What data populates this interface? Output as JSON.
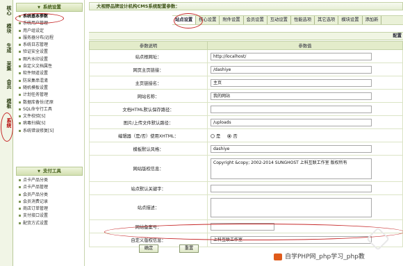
{
  "left_tabs": [
    {
      "label": "核心"
    },
    {
      "label": "模块"
    },
    {
      "label": "生成"
    },
    {
      "label": "采集"
    },
    {
      "label": "会员"
    },
    {
      "label": "模板"
    },
    {
      "label": "系统",
      "active": true
    }
  ],
  "menu": {
    "group1_title": "系统设置",
    "group1_items": [
      {
        "label": "系统基本参数",
        "active": true
      },
      {
        "label": "系统用户管理"
      },
      {
        "label": "用户组设定"
      },
      {
        "label": "服务器分布/远程"
      },
      {
        "label": "系统日志管理"
      },
      {
        "label": "验证安全设置"
      },
      {
        "label": "图片水印设置"
      },
      {
        "label": "自定义文档属性"
      },
      {
        "label": "软件频道设置"
      },
      {
        "label": "防采集串混淆"
      },
      {
        "label": "随机模板设置"
      },
      {
        "label": "计划任务管理"
      },
      {
        "label": "数据库备份/还原"
      },
      {
        "label": "SQL命令行工具"
      },
      {
        "label": "文件校验[S]"
      },
      {
        "label": "病毒扫描[S]"
      },
      {
        "label": "系统错误修复[S]"
      }
    ],
    "group2_title": "支付工具",
    "group2_items": [
      {
        "label": "点卡产品分类"
      },
      {
        "label": "点卡产品管理"
      },
      {
        "label": "会员产品分类"
      },
      {
        "label": "会员消费记录"
      },
      {
        "label": "商店订单管理"
      },
      {
        "label": "支付接口设置"
      },
      {
        "label": "配货方式设置"
      }
    ]
  },
  "header": {
    "title": "大视野品牌设计机构CMS系统配置参数："
  },
  "tabs": [
    {
      "label": "站点设置",
      "active": true
    },
    {
      "label": "核心设置"
    },
    {
      "label": "附件设置"
    },
    {
      "label": "会员设置"
    },
    {
      "label": "互动设置"
    },
    {
      "label": "性能选项"
    },
    {
      "label": "其它选项"
    },
    {
      "label": "模块设置"
    },
    {
      "label": "添加新"
    }
  ],
  "config_head": "配置",
  "table": {
    "col_name": "参数说明",
    "col_value": "参数值",
    "rows": [
      {
        "label": "站点根网址：",
        "value": "http://localhost/"
      },
      {
        "label": "网页主页链接：",
        "value": "/dashiye"
      },
      {
        "label": "主页链接名：",
        "value": "主页"
      },
      {
        "label": "网站名称：",
        "value": "我的网站"
      },
      {
        "label": "文档HTML默认保存路径：",
        "value": ""
      },
      {
        "label": "图片/上传文件默认路径：",
        "value": "/uploads"
      },
      {
        "label": "编辑器（是/否）使用XHTML：",
        "opt_yes": "是",
        "opt_no": "否"
      },
      {
        "label": "模板默认风格：",
        "value": "dashiye"
      },
      {
        "label": "网站版权信息：",
        "value": "Copyright &copy; 2002-2014 SUNGHOST 上科互联工作室 版权所有"
      },
      {
        "label": "站点默认关键字：",
        "value": ""
      },
      {
        "label": "站点描述：",
        "value": ""
      },
      {
        "label": "网站备案号：",
        "value": ""
      },
      {
        "label": "自定义版权信息：",
        "value": "上科互联工作室"
      }
    ]
  },
  "buttons": {
    "confirm": "确定",
    "reset": "重置"
  },
  "watermark": "自学PHP网_php学习_php教"
}
